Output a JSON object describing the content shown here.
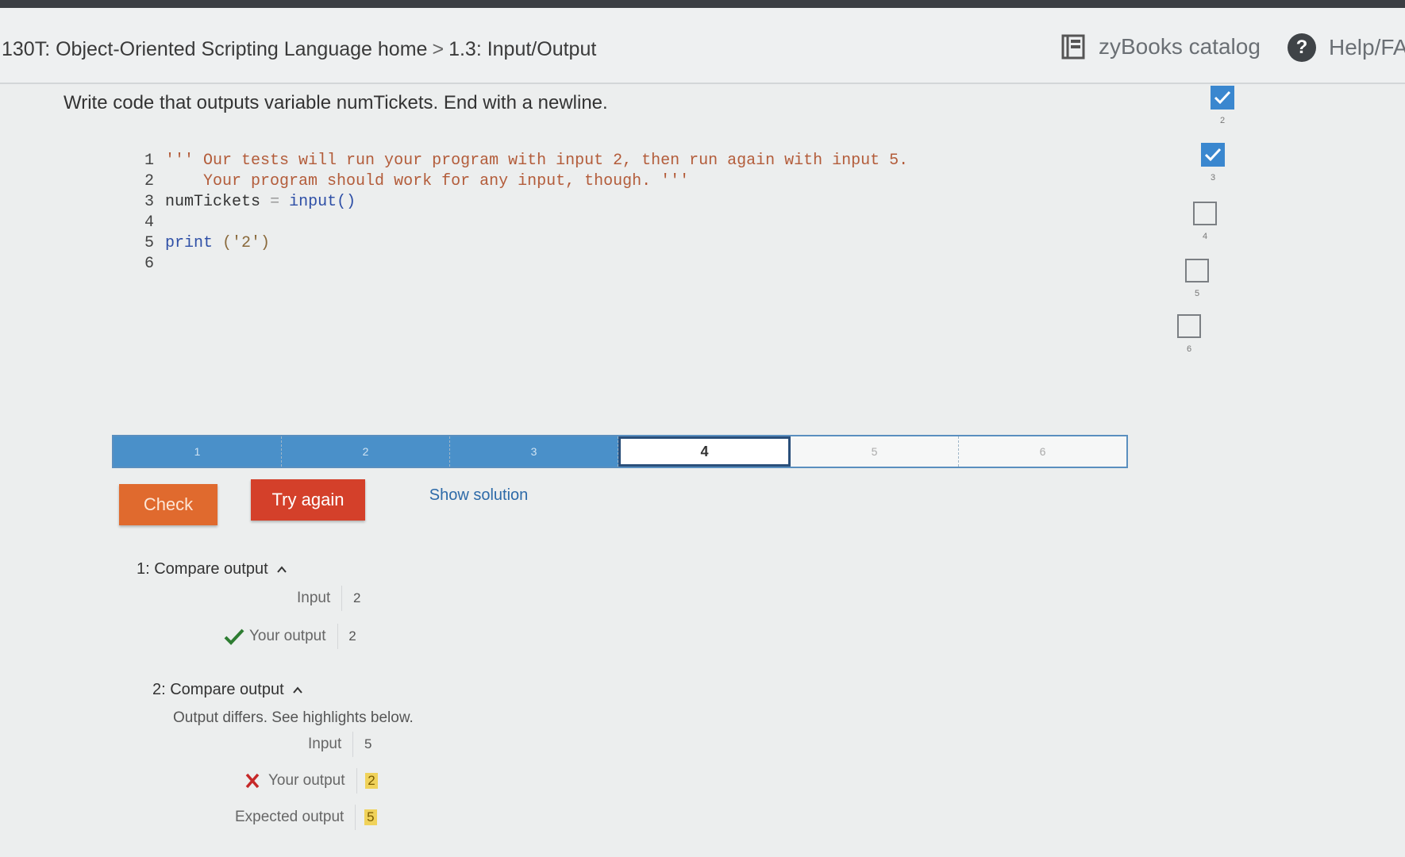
{
  "header": {
    "breadcrumb_course": "130T: Object-Oriented Scripting Language home",
    "breadcrumb_sep": ">",
    "breadcrumb_section": "1.3: Input/Output",
    "catalog_label": "zyBooks catalog",
    "help_label": "Help/FA",
    "help_glyph": "?"
  },
  "prompt": "Write code that outputs variable numTickets. End with a newline.",
  "editor": {
    "lines": [
      {
        "num": "1",
        "comment": "''' Our tests will run your program with input 2, then run again with input 5."
      },
      {
        "num": "2",
        "comment": "    Your program should work for any input, though. '''"
      },
      {
        "num": "3",
        "var": "numTickets",
        "op": "=",
        "call": "input()"
      },
      {
        "num": "4"
      },
      {
        "num": "5",
        "kw": "print",
        "args": "('2')"
      },
      {
        "num": "6"
      }
    ]
  },
  "progress": {
    "levels": [
      "1",
      "2",
      "3",
      "4",
      "5",
      "6"
    ],
    "current": "4"
  },
  "buttons": {
    "check": "Check",
    "try_again": "Try again",
    "show_solution": "Show solution"
  },
  "tests": [
    {
      "title": "1: Compare output",
      "input_label": "Input",
      "input_value": "2",
      "your_output_label": "Your output",
      "your_output_value": "2",
      "status": "pass"
    },
    {
      "title": "2: Compare output",
      "note": "Output differs. See highlights below.",
      "input_label": "Input",
      "input_value": "5",
      "your_output_label": "Your output",
      "your_output_value": "2",
      "expected_label": "Expected output",
      "expected_value": "5",
      "status": "fail"
    }
  ],
  "side_checklist": [
    {
      "num": "2",
      "done": true
    },
    {
      "num": "3",
      "done": true
    },
    {
      "num": "4",
      "done": false
    },
    {
      "num": "5",
      "done": false
    },
    {
      "num": "6",
      "done": false
    }
  ],
  "colors": {
    "accent_blue": "#4a90c9",
    "check_orange": "#e06a2e",
    "try_red": "#d4402a",
    "pass_green": "#2e7d32",
    "fail_red": "#c62828",
    "highlight_yellow": "#f0d25a"
  },
  "icons": {
    "catalog": "book-icon",
    "help": "help-icon",
    "pass": "checkmark-icon",
    "fail": "x-icon",
    "expand": "chevron-up-icon"
  }
}
